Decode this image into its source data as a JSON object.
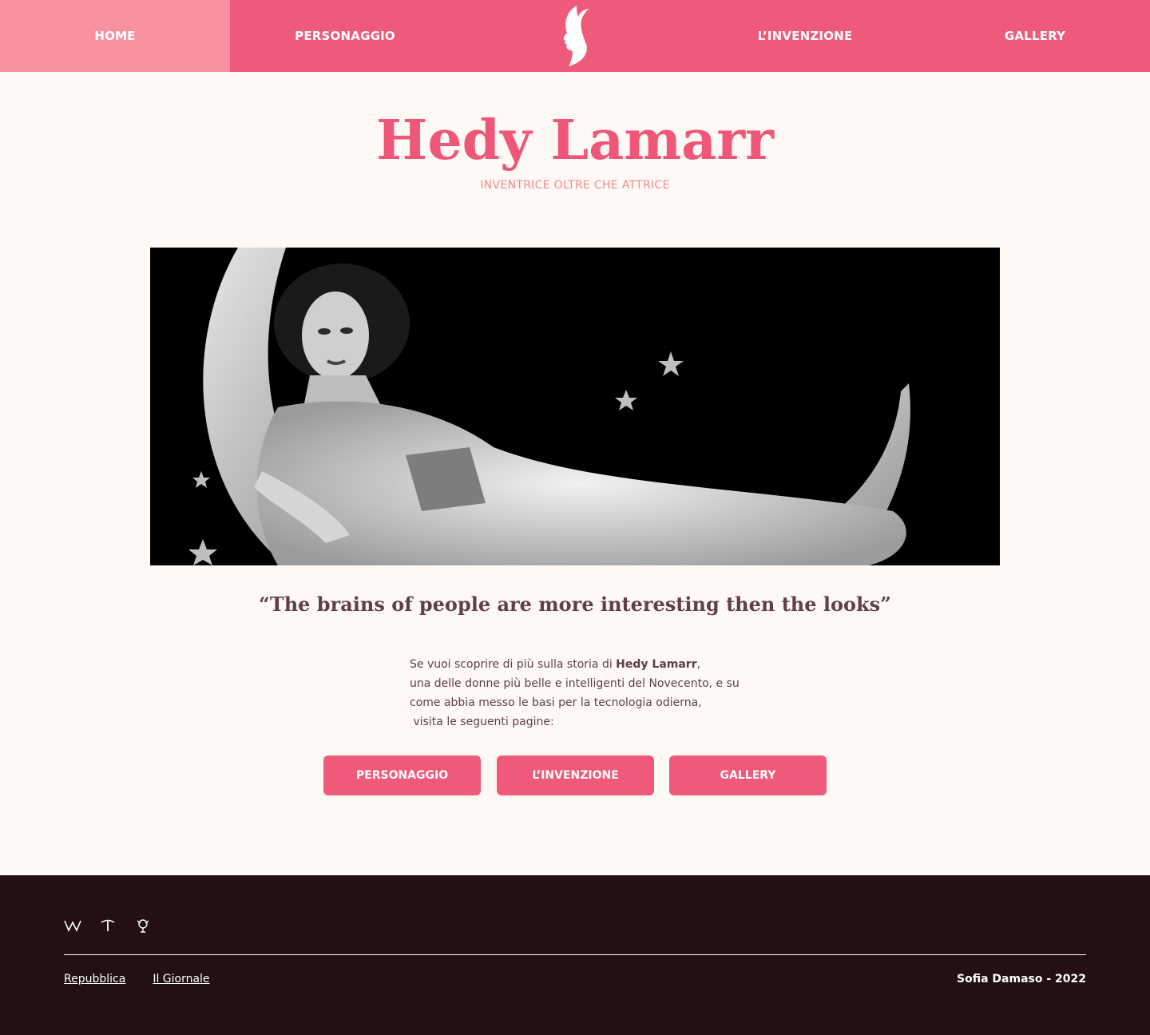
{
  "nav": {
    "home": "HOME",
    "personaggio": "PERSONAGGIO",
    "invenzione": "L’INVENZIONE",
    "gallery": "GALLERY",
    "logo_icon": "woman-profile-logo-icon"
  },
  "hero": {
    "title": "Hedy Lamarr",
    "subtitle": "INVENTRICE OLTRE CHE ATTRICE"
  },
  "quote": "“The brains of people are more interesting then the looks”",
  "intro": {
    "line1_prefix": "Se vuoi scoprire di più sulla storia di ",
    "line1_name": "Hedy Lamarr",
    "line1_suffix": ",",
    "line2": "una delle donne più belle e intelligenti del Novecento, e su",
    "line3": "come abbia messo le basi per la tecnologia odierna,",
    "line4": " visita le seguenti pagine:"
  },
  "cta": {
    "personaggio": "PERSONAGGIO",
    "invenzione": "L’INVENZIONE",
    "gallery": "GALLERY"
  },
  "footer": {
    "icons": [
      "wikipedia-icon",
      "treccani-icon",
      "rai-icon"
    ],
    "link1": "Repubblica",
    "link2": "Il Giornale",
    "credit": "Sofia Damaso - 2022"
  },
  "colors": {
    "brand_pink": "#ef5a7a",
    "active_tab": "#f7919f",
    "page_bg": "#fff9f6",
    "footer_bg": "#221012"
  }
}
